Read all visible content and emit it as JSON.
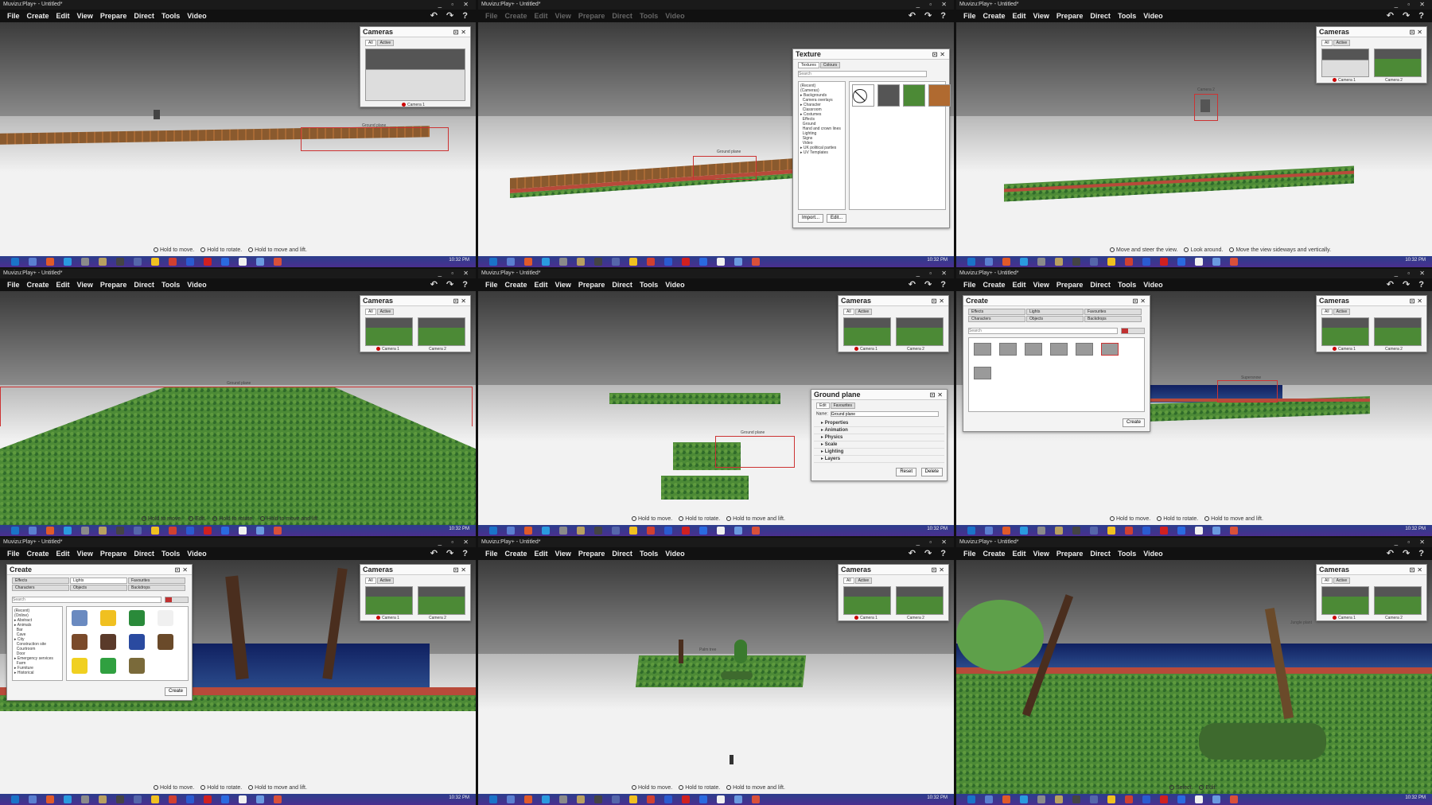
{
  "app": {
    "window_title": "Muvizu:Play+ - Untitled*",
    "menu": [
      "File",
      "Create",
      "Edit",
      "View",
      "Prepare",
      "Direct",
      "Tools",
      "Video"
    ],
    "window_controls": "_ ▫ ✕",
    "toolbar_icons": "↶ ↷ ?",
    "taskbar_icon_colors": [
      "#1a73c8",
      "#5a7fd0",
      "#e05a2a",
      "#2a9adf",
      "#8a8a8a",
      "#b8a060",
      "#444444",
      "#5566aa",
      "#f0c020",
      "#d04030",
      "#2a5bd0",
      "#d02020",
      "#2a6ae0",
      "#f0f0f0",
      "#6a9ae0",
      "#d9503a"
    ]
  },
  "tiles": [
    {
      "id": "t1",
      "hints": [
        "Hold to move.",
        "Hold to rotate.",
        "Hold to move and lift."
      ],
      "cameras_panel": {
        "title": "Cameras",
        "tabs": [
          "All",
          "Active"
        ],
        "cams": [
          "Camera 1"
        ]
      },
      "label": "Ground plane"
    },
    {
      "id": "t2",
      "texture_panel": {
        "title": "Texture",
        "tabs": [
          "Textures",
          "Colours"
        ],
        "search_placeholder": "Search",
        "tree": "(Recent)\n(Cameras)\n▸ Backgrounds\n  Camera overlays\n▸ Character\n  Classroom\n▸ Costumes\n  Effects\n  Ground\n  Hand and crown lines\n  Lighting\n  Signs\n  Video\n▸ UK political parties\n▸ UV Templates",
        "import_label": "Import...",
        "edit_label": "Edit..."
      },
      "label": "Ground plane"
    },
    {
      "id": "t3",
      "hints": [
        "Move and steer the view.",
        "Look around.",
        "Move the view sideways and vertically."
      ],
      "cameras_panel": {
        "title": "Cameras",
        "tabs": [
          "All",
          "Active"
        ],
        "cams": [
          "Camera 1",
          "Camera 2"
        ]
      },
      "label": "Camera 2"
    },
    {
      "id": "t4",
      "hints": [
        "Hold to move.",
        "Edit.",
        "Hold to rotate.",
        "Hold to move and lift."
      ],
      "cameras_panel": {
        "title": "Cameras",
        "tabs": [
          "All",
          "Active"
        ],
        "cams": [
          "Camera 1",
          "Camera 2"
        ]
      },
      "label": "Ground plane"
    },
    {
      "id": "t5",
      "hints": [
        "Hold to move.",
        "Hold to rotate.",
        "Hold to move and lift."
      ],
      "cameras_panel": {
        "title": "Cameras",
        "tabs": [
          "All",
          "Active"
        ],
        "cams": [
          "Camera 1",
          "Camera 2"
        ]
      },
      "ground_panel": {
        "title": "Ground plane",
        "tabs": [
          "Edit",
          "Favourites"
        ],
        "name_label": "Name:",
        "name_value": "Ground plane",
        "sections": [
          "Properties",
          "Animation",
          "Physics",
          "Scale",
          "Lighting",
          "Layers"
        ],
        "reset_label": "Reset",
        "delete_label": "Delete"
      },
      "label": "Ground plane"
    },
    {
      "id": "t6",
      "hints": [
        "Hold to move.",
        "Hold to rotate.",
        "Hold to move and lift."
      ],
      "cameras_panel": {
        "title": "Cameras",
        "tabs": [
          "All",
          "Active"
        ],
        "cams": [
          "Camera 1",
          "Camera 2"
        ]
      },
      "create_panel": {
        "title": "Create",
        "tabs": [
          "Effects",
          "Lights",
          "Favourites",
          "Characters",
          "Objects",
          "Backdrops"
        ],
        "search_placeholder": "Search",
        "create_label": "Create"
      },
      "label": "Supersnow"
    },
    {
      "id": "t7",
      "hints": [
        "Hold to move.",
        "Hold to rotate.",
        "Hold to move and lift."
      ],
      "cameras_panel": {
        "title": "Cameras",
        "tabs": [
          "All",
          "Active"
        ],
        "cams": [
          "Camera 1",
          "Camera 2"
        ]
      },
      "create_panel": {
        "title": "Create",
        "tabs": [
          "Effects",
          "Lights",
          "Favourites",
          "Characters",
          "Objects",
          "Backdrops"
        ],
        "search_placeholder": "Search",
        "tree": "(Recent)\n(Online)\n▸ Abstract\n▸ Animals\n  Bar\n  Cave\n▸ City\n  Construction site\n  Courtroom\n  Door\n▸ Emergency services\n  Farm\n▸ Furniture\n▸ Historical",
        "create_label": "Create"
      }
    },
    {
      "id": "t8",
      "hints": [
        "Hold to move.",
        "Hold to rotate.",
        "Hold to move and lift."
      ],
      "cameras_panel": {
        "title": "Cameras",
        "tabs": [
          "All",
          "Active"
        ],
        "cams": [
          "Camera 1",
          "Camera 2"
        ]
      },
      "label": "Palm tree"
    },
    {
      "id": "t9",
      "hints": [
        "Select.",
        "Edit."
      ],
      "cameras_panel": {
        "title": "Cameras",
        "tabs": [
          "All",
          "Active"
        ],
        "cams": [
          "Camera 1",
          "Camera 2"
        ]
      },
      "label": "Jungle plant"
    }
  ],
  "clock": "10:32 PM"
}
